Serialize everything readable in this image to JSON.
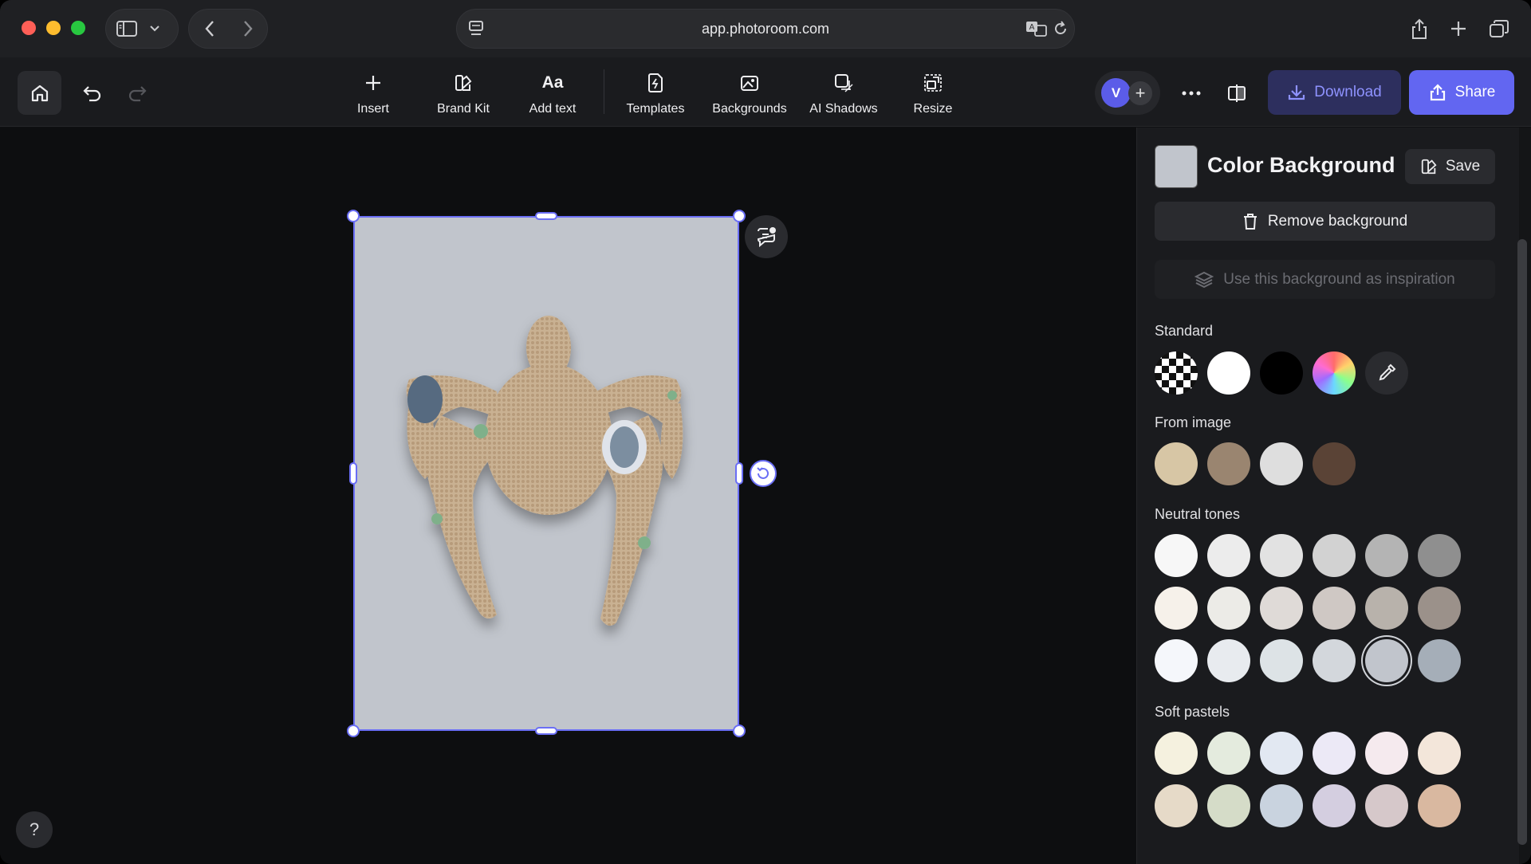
{
  "browser": {
    "url": "app.photoroom.com"
  },
  "toolbar": {
    "tools": [
      {
        "label": "Insert"
      },
      {
        "label": "Brand Kit"
      },
      {
        "label": "Add text",
        "icon_text": "Aa"
      },
      {
        "label": "Templates"
      },
      {
        "label": "Backgrounds"
      },
      {
        "label": "AI Shadows"
      },
      {
        "label": "Resize"
      }
    ],
    "avatar_initial": "V",
    "download_label": "Download",
    "share_label": "Share"
  },
  "canvas": {
    "help_label": "?"
  },
  "panel": {
    "title": "Color Background",
    "current_color": "#c1c5cc",
    "save_label": "Save",
    "remove_label": "Remove background",
    "inspiration_label": "Use this background as inspiration",
    "sections": {
      "standard": "Standard",
      "from_image": "From image",
      "neutral": "Neutral tones",
      "pastels": "Soft pastels"
    },
    "from_image_colors": [
      "#d7c6a5",
      "#9a8570",
      "#dedede",
      "#5a4336"
    ],
    "neutral_colors": [
      [
        "#f7f7f7",
        "#ececec",
        "#e2e2e2",
        "#d2d2d2",
        "#b4b4b4",
        "#8f8f8f"
      ],
      [
        "#f6f1ea",
        "#ecebe7",
        "#dfdad7",
        "#cfc8c4",
        "#b8b2ab",
        "#9b918a"
      ],
      [
        "#f5f7fb",
        "#e8ebef",
        "#dde3e6",
        "#d3d7dc",
        "#c1c5cc",
        "#a5aeb8"
      ]
    ],
    "neutral_selected": "#c1c5cc",
    "pastel_colors": [
      [
        "#f5f1df",
        "#e4ebde",
        "#e2e8f2",
        "#ece9f6",
        "#f5eaee",
        "#f3e6da"
      ],
      [
        "#e6dac8",
        "#d5dcc8",
        "#c9d3df",
        "#d4cee0",
        "#d6c8ca",
        "#d9b8a0"
      ]
    ]
  }
}
